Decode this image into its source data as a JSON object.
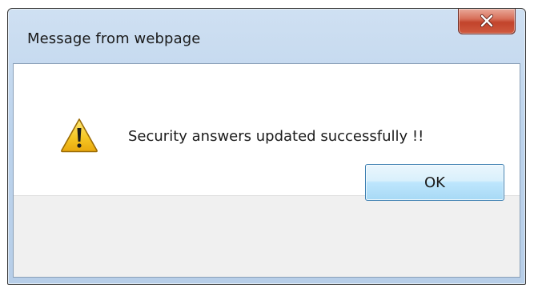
{
  "dialog": {
    "title": "Message from webpage",
    "close_icon": "close-icon",
    "message_icon": "warning-icon",
    "message": "Security answers updated successfully !!",
    "ok_label": "OK"
  },
  "colors": {
    "titlebar": "#bcd3ec",
    "close_button": "#c2432b",
    "ok_button": "#bee6fd",
    "button_bar": "#f0f0f0",
    "warning": "#f3c51a"
  }
}
